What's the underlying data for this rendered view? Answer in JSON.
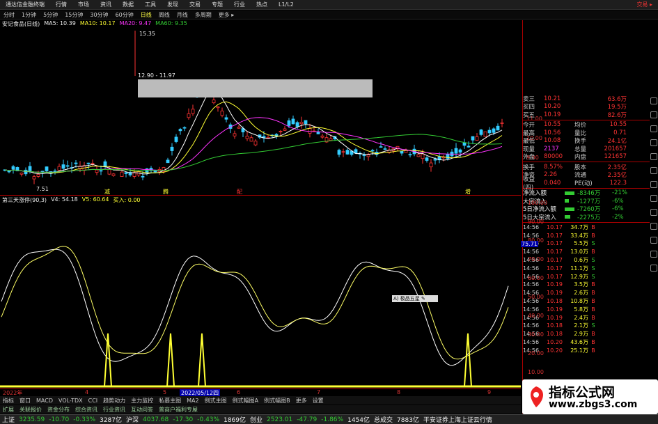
{
  "titlebar": {
    "app": "通达信金融终端",
    "menus": [
      "行情",
      "市场",
      "资讯",
      "数据",
      "工具",
      "发现",
      "交易",
      "专题",
      "行业",
      "热点",
      "L1/L2"
    ],
    "trade_label": "交易 ▸"
  },
  "periodbar": {
    "items": [
      "分时",
      "1分钟",
      "5分钟",
      "15分钟",
      "30分钟",
      "60分钟",
      "日线",
      "周线",
      "月线",
      "多周期",
      "更多 ▸"
    ],
    "active": "日线"
  },
  "mainchart": {
    "stock": "安记食品(日线)",
    "ma5": "MA5: 10.39",
    "ma10": "MA10: 10.17",
    "ma20": "MA20: 9.47",
    "ma60": "MA60: 9.35",
    "high_label": "15.35",
    "range_label": "12.90 - 11.97",
    "low_label": "7.51",
    "price_scale": [
      "11.00",
      "10.00",
      "9.00"
    ],
    "markers": [
      "减",
      "腾",
      "配",
      "增"
    ]
  },
  "indicator": {
    "name": "第三天涨停(90,3)",
    "v4": "V4: 54.18",
    "v5": "V5: 60.64",
    "buy": "买入: 0.00",
    "scale": [
      "100.00",
      "90.00",
      "80.00",
      "70.00",
      "60.00",
      "50.00",
      "40.00",
      "30.00",
      "20.00",
      "10.00"
    ],
    "cursor_value": "75.71",
    "tip": "A) 极品五星 ✎"
  },
  "datebar": {
    "left": "2022年",
    "date": "2022/05/12四",
    "cols": [
      "4",
      "5",
      "6",
      "7",
      "8",
      "9"
    ]
  },
  "tabbar": {
    "items": [
      "指标",
      "窗口",
      "MACD",
      "VOL-TDX",
      "CCI",
      "趋势动力",
      "主力监控",
      "私募主图",
      "MA2",
      "例式主图",
      "例式幅图A",
      "例式幅图B",
      "更多",
      "设置"
    ]
  },
  "tabbar2": {
    "items": [
      "扩展",
      "关联报价",
      "资金分布",
      "综合资讯",
      "行业资讯",
      "互动问答",
      "普商户福利专屋"
    ]
  },
  "quotes": {
    "asks": [
      {
        "label": "卖三",
        "price": "10.21",
        "vol": "63.6万"
      },
      {
        "label": "买四",
        "price": "10.20",
        "vol": "19.5万"
      },
      {
        "label": "买五",
        "price": "10.19",
        "vol": "82.6万"
      }
    ],
    "stats": [
      {
        "k1": "今开",
        "v1": "10.55",
        "k2": "均价",
        "v2": "10.55"
      },
      {
        "k1": "最高",
        "v1": "10.56",
        "k2": "量比",
        "v2": "0.71"
      },
      {
        "k1": "最低",
        "v1": "10.08",
        "k2": "换手",
        "v2": "24.1亿"
      },
      {
        "k1": "现量",
        "v1": "2137",
        "k2": "总量",
        "v2": "201657"
      },
      {
        "k1": "外盘",
        "v1": "80000",
        "k2": "内盘",
        "v2": "121657"
      },
      {
        "k1": "换手",
        "v1": "8.57%",
        "k2": "股本",
        "v2": "2.35亿"
      },
      {
        "k1": "净资",
        "v1": "2.26",
        "k2": "流通",
        "v2": "2.35亿"
      },
      {
        "k1": "收益(四)",
        "v1": "0.040",
        "k2": "PE(动)",
        "v2": "122.3"
      }
    ],
    "flows": [
      {
        "label": "净流入额",
        "value": "-8346万",
        "pct": "-21%"
      },
      {
        "label": "大宗流入",
        "value": "-1277万",
        "pct": "-6%"
      },
      {
        "label": "5日净流入额",
        "value": "-7260万",
        "pct": "-6%"
      },
      {
        "label": "5日大宗流入",
        "value": "-2275万",
        "pct": "-2%"
      }
    ],
    "ticks": [
      {
        "t": "14:56",
        "p": "10.17",
        "v": "34.7万",
        "bs": "B"
      },
      {
        "t": "14:56",
        "p": "10.17",
        "v": "33.4万",
        "bs": "B"
      },
      {
        "t": "14:56",
        "p": "10.17",
        "v": "5.5万",
        "bs": "S"
      },
      {
        "t": "14:56",
        "p": "10.17",
        "v": "13.0万",
        "bs": "B"
      },
      {
        "t": "14:56",
        "p": "10.17",
        "v": "0.6万",
        "bs": "S"
      },
      {
        "t": "14:56",
        "p": "10.17",
        "v": "11.1万",
        "bs": "S"
      },
      {
        "t": "14:56",
        "p": "10.17",
        "v": "12.9万",
        "bs": "S"
      },
      {
        "t": "14:56",
        "p": "10.19",
        "v": "3.5万",
        "bs": "B"
      },
      {
        "t": "14:56",
        "p": "10.19",
        "v": "2.6万",
        "bs": "B"
      },
      {
        "t": "14:56",
        "p": "10.18",
        "v": "10.8万",
        "bs": "B"
      },
      {
        "t": "14:56",
        "p": "10.19",
        "v": "5.8万",
        "bs": "B"
      },
      {
        "t": "14:56",
        "p": "10.19",
        "v": "2.4万",
        "bs": "B"
      },
      {
        "t": "14:56",
        "p": "10.18",
        "v": "2.1万",
        "bs": "S"
      },
      {
        "t": "14:56",
        "p": "10.18",
        "v": "2.9万",
        "bs": "B"
      },
      {
        "t": "14:56",
        "p": "10.20",
        "v": "43.6万",
        "bs": "B"
      },
      {
        "t": "14:56",
        "p": "10.20",
        "v": "25.1万",
        "bs": "B"
      }
    ]
  },
  "statusbar": [
    {
      "label": "上证",
      "val": "3235.59",
      "chg": "-10.70",
      "pct": "-0.33%",
      "amt": "3287亿"
    },
    {
      "label": "沪深",
      "val": "4037.68",
      "chg": "-17.30",
      "pct": "-0.43%",
      "amt": "1869亿"
    },
    {
      "label": "创业",
      "val": "2523.01",
      "chg": "-47.79",
      "pct": "-1.86%",
      "amt": "1454亿"
    },
    {
      "label": "总成交",
      "amt": "7883亿"
    }
  ],
  "status_extra": "平安证券上海上证云行情",
  "watermark": {
    "title": "指标公式网",
    "url": "www.zbgs3.com"
  },
  "colors": {
    "up": "#ff3333",
    "down": "#33ccff",
    "ma5": "#ffffff",
    "ma10": "#ffff33",
    "ma20": "#ff33ff",
    "ma60": "#33cc33",
    "signal": "#ffff33"
  }
}
